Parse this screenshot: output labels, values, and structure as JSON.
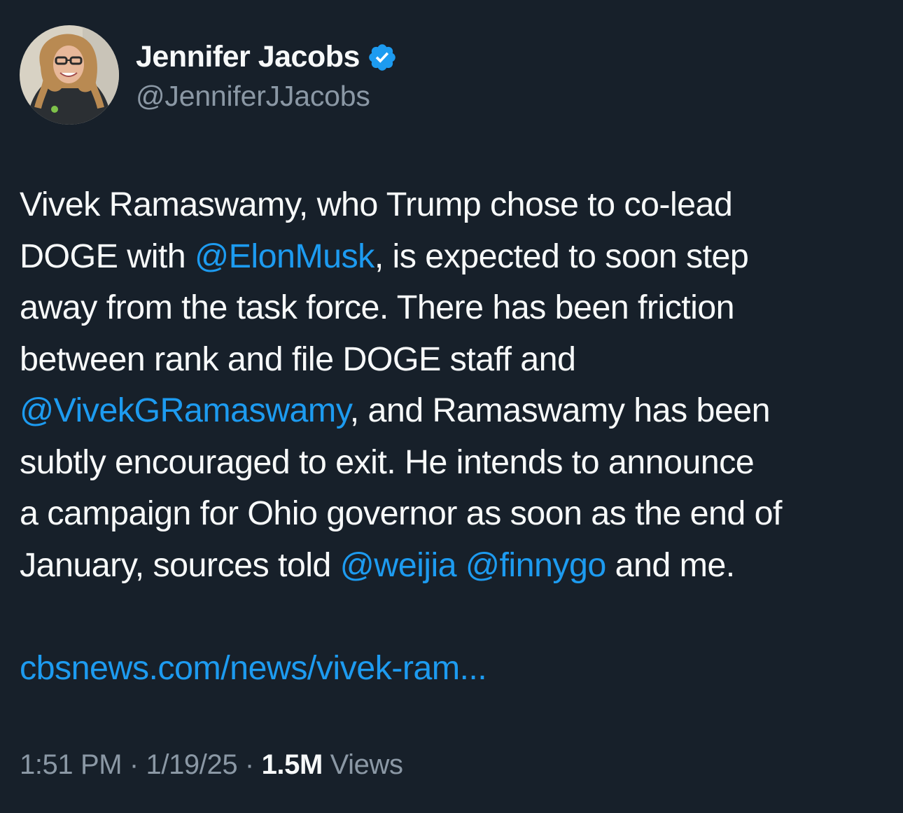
{
  "author": {
    "display_name": "Jennifer Jacobs",
    "handle": "@JenniferJJacobs",
    "verified_icon": "verified-badge-icon",
    "verified_color": "#1d9bf0"
  },
  "tweet": {
    "line1": "Vivek Ramaswamy, who Trump chose to co-lead",
    "line2_pre": "DOGE with ",
    "mention_elon": "@ElonMusk",
    "line2_post": ", is expected to soon step",
    "line3": "away from the task force. There has been friction",
    "line4": "between rank and file DOGE staff and",
    "mention_vivek": "@VivekGRamaswamy",
    "line5_post": ", and Ramaswamy has been",
    "line6": "subtly encouraged to exit. He intends to announce",
    "line7": "a campaign for Ohio governor as soon as the end of",
    "line8_pre": "January, sources told ",
    "mention_weijia": "@weijia",
    "mention_finnygo": "@finnygo",
    "line8_post": " and me.",
    "link": "cbsnews.com/news/vivek-ram..."
  },
  "meta": {
    "time": "1:51 PM",
    "date": "1/19/25",
    "separator": "·",
    "views_count": "1.5M",
    "views_label": "Views"
  },
  "colors": {
    "background": "#17202a",
    "text": "#f7f9f9",
    "secondary": "#8b98a5",
    "accent": "#1d9bf0"
  }
}
